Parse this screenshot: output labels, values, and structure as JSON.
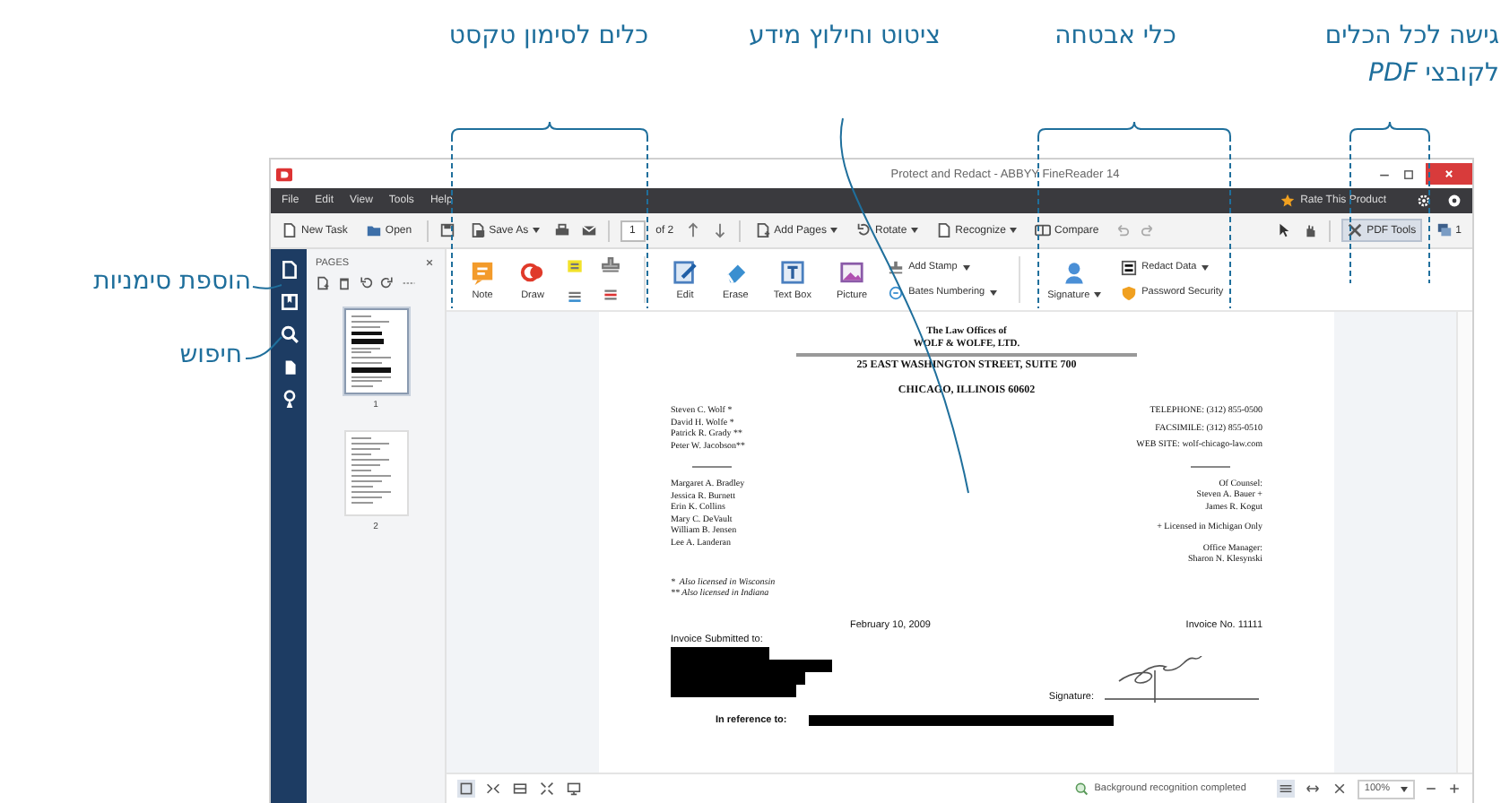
{
  "callouts": {
    "top": [
      {
        "lines": [
          "גישה לכל הכלים",
          "לקובצי *PDF*"
        ]
      },
      {
        "lines": [
          "כלי אבטחה"
        ]
      },
      {
        "lines": [
          "ציטוט וחילוץ מידע"
        ]
      },
      {
        "lines": [
          "כלים לסימון טקסט"
        ]
      }
    ],
    "left": [
      "הוספת סימניות",
      "חיפוש"
    ]
  },
  "window": {
    "title": "Protect and Redact - ABBYY FineReader 14"
  },
  "menu": [
    "File",
    "Edit",
    "View",
    "Tools",
    "Help"
  ],
  "menu_right": {
    "rate": "Rate This Product"
  },
  "toolbar": {
    "new_task": "New Task",
    "open": "Open",
    "save_as": "Save As",
    "page": "1",
    "page_total": "of 2",
    "add_pages": "Add Pages",
    "rotate": "Rotate",
    "recognize": "Recognize",
    "compare": "Compare",
    "pdf_tools": {
      "label": "PDF Tools",
      "selected": true
    },
    "comments": "1"
  },
  "pages_panel": {
    "title": "PAGES",
    "thumbnails": [
      {
        "number": "1",
        "selected": true
      },
      {
        "number": "2",
        "selected": false
      }
    ]
  },
  "ribbon": [
    {
      "kind": "large",
      "label": "Note",
      "dropdown": false
    },
    {
      "kind": "large",
      "label": "Draw",
      "dropdown": false
    },
    {
      "kind": "icons"
    },
    {
      "kind": "separator"
    },
    {
      "kind": "large",
      "label": "Edit",
      "dropdown": false
    },
    {
      "kind": "large",
      "label": "Erase",
      "dropdown": false
    },
    {
      "kind": "large",
      "label": "Text Box",
      "dropdown": false
    },
    {
      "kind": "large",
      "label": "Picture",
      "dropdown": false
    },
    {
      "kind": "stack",
      "items": [
        {
          "label": "Add Stamp",
          "dropdown": true
        },
        {
          "label": "Bates Numbering",
          "dropdown": true
        }
      ]
    },
    {
      "kind": "separator"
    },
    {
      "kind": "large",
      "label": "Signature",
      "dropdown": true
    },
    {
      "kind": "stack",
      "items": [
        {
          "label": "Redact Data",
          "dropdown": true
        },
        {
          "label": "Password Security",
          "dropdown": false
        }
      ]
    }
  ],
  "document": {
    "letterhead": [
      "The Law Offices of",
      "WOLF & WOLFE, LTD."
    ],
    "street": "25 EAST WASHINGTON STREET, SUITE 700",
    "city": "CHICAGO, ILLINOIS 60602",
    "partners": [
      "Steven C. Wolf *",
      "David H. Wolfe *",
      "Patrick R. Grady **",
      "Peter W. Jacobson**"
    ],
    "contact": [
      "TELEPHONE: (312) 855-0500",
      "FACSIMILE: (312) 855-0510",
      "WEB SITE: wolf-chicago-law.com"
    ],
    "associates": [
      "Margaret A. Bradley",
      "Jessica R. Burnett",
      "Erin K. Collins",
      "Mary C. DeVault",
      "William B. Jensen",
      "Lee A. Landeran"
    ],
    "counsel": [
      "Of Counsel:",
      "Steven A. Bauer +",
      "James R. Kogut"
    ],
    "counsel_note": "+ Licensed in Michigan Only",
    "manager": [
      "Office Manager:",
      "Sharon N. Klesynski"
    ],
    "footnotes": [
      "*  Also licensed in Wisconsin",
      "** Also licensed in Indiana"
    ],
    "date": "February 10, 2009",
    "invoice_no": "Invoice No. 11111",
    "submitted_label": "Invoice Submitted to:",
    "signature_label": "Signature:",
    "reference_label": "In reference to:"
  },
  "status_bar": {
    "message": "Background recognition completed",
    "zoom": "100%"
  }
}
